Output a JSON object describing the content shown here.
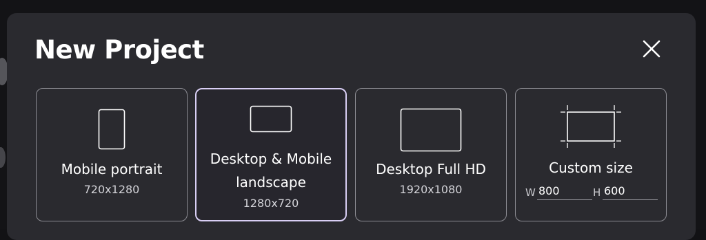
{
  "dialog": {
    "title": "New Project",
    "close_icon": "close-icon"
  },
  "presets": [
    {
      "name": "Mobile portrait",
      "size": "720x1280",
      "icon": "phone-portrait-icon",
      "selected": false
    },
    {
      "name_line1": "Desktop & Mobile",
      "name_line2": "landscape",
      "size": "1280x720",
      "icon": "landscape-icon",
      "selected": true
    },
    {
      "name": "Desktop Full HD",
      "size": "1920x1080",
      "icon": "monitor-icon",
      "selected": false
    },
    {
      "name": "Custom size",
      "icon": "crop-frame-icon",
      "selected": false,
      "width_label": "W",
      "width_value": "800",
      "height_label": "H",
      "height_value": "600"
    }
  ],
  "colors": {
    "modal_bg": "#2a2a2f",
    "card_border": "#8d8d94",
    "selected_border": "#d9cff5",
    "text": "#ffffff"
  }
}
